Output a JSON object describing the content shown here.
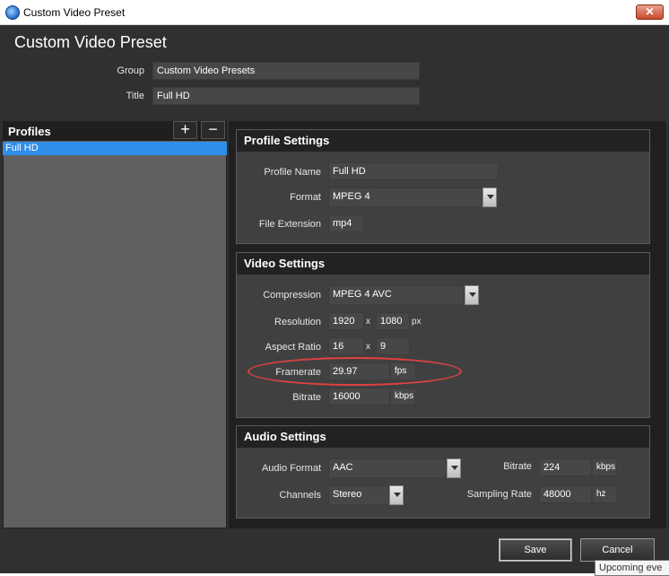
{
  "window": {
    "title": "Custom Video Preset",
    "close_glyph": "✕"
  },
  "header": {
    "title": "Custom Video Preset",
    "group_label": "Group",
    "group_value": "Custom Video Presets",
    "title_label": "Title",
    "title_value": "Full HD"
  },
  "profiles": {
    "heading": "Profiles",
    "add_glyph": "+",
    "remove_glyph": "−",
    "items": [
      {
        "label": "Full HD",
        "selected": true
      }
    ]
  },
  "profile_settings": {
    "heading": "Profile Settings",
    "name_label": "Profile Name",
    "name_value": "Full HD",
    "format_label": "Format",
    "format_value": "MPEG 4",
    "ext_label": "File Extension",
    "ext_value": "mp4"
  },
  "video_settings": {
    "heading": "Video Settings",
    "compression_label": "Compression",
    "compression_value": "MPEG 4 AVC",
    "resolution_label": "Resolution",
    "res_width": "1920",
    "res_x": "x",
    "res_height": "1080",
    "res_unit": "px",
    "aspect_label": "Aspect Ratio",
    "aspect_w": "16",
    "aspect_x": "x",
    "aspect_h": "9",
    "framerate_label": "Framerate",
    "framerate_value": "29.97",
    "framerate_unit": "fps",
    "bitrate_label": "Bitrate",
    "bitrate_value": "16000",
    "bitrate_unit": "kbps"
  },
  "audio_settings": {
    "heading": "Audio Settings",
    "format_label": "Audio Format",
    "format_value": "AAC",
    "channels_label": "Channels",
    "channels_value": "Stereo",
    "bitrate_label": "Bitrate",
    "bitrate_value": "224",
    "bitrate_unit": "kbps",
    "sampling_label": "Sampling Rate",
    "sampling_value": "48000",
    "sampling_unit": "hz"
  },
  "footer": {
    "save_label": "Save",
    "cancel_label": "Cancel"
  },
  "tooltip": {
    "text": "Upcoming eve"
  },
  "colors": {
    "highlight": "#e04040",
    "selection": "#2f8ee8"
  }
}
